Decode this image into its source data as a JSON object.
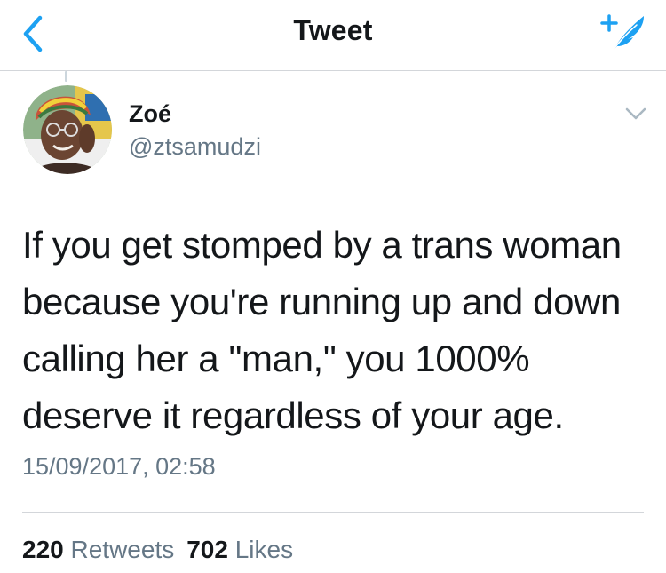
{
  "navbar": {
    "title": "Tweet",
    "back_icon": "chevron-left-icon",
    "compose_icon": "compose-tweet-icon",
    "accent_color": "#1da1f2"
  },
  "tweet": {
    "author": {
      "display_name": "Zoé",
      "handle": "@ztsamudzi"
    },
    "text_lines": [
      "If you get stomped by a trans woman",
      "because you're running up and down",
      "calling her a \"man,\" you 1000%",
      "deserve it regardless of your age."
    ],
    "timestamp": "15/09/2017, 02:58",
    "stats": {
      "retweets_count": "220",
      "retweets_label": "Retweets",
      "likes_count": "702",
      "likes_label": "Likes"
    },
    "menu_icon": "chevron-down-icon"
  },
  "colors": {
    "text_primary": "#14171a",
    "text_secondary": "#657786",
    "divider": "#d3d6da"
  }
}
